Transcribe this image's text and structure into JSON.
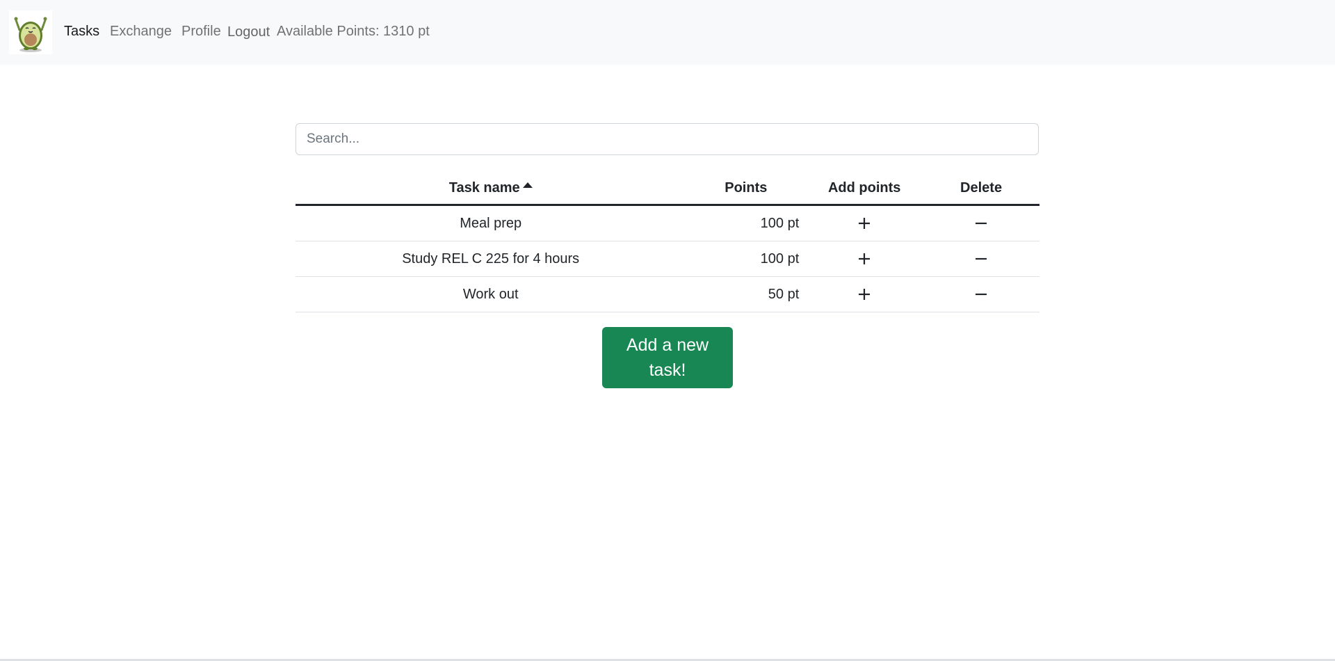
{
  "nav": {
    "links": [
      {
        "label": "Tasks",
        "active": true
      },
      {
        "label": "Exchange",
        "active": false
      },
      {
        "label": "Profile",
        "active": false
      }
    ],
    "logout_label": "Logout",
    "available_points": "Available Points: 1310 pt",
    "logo_icon": "avocado-mascot-icon"
  },
  "search": {
    "placeholder": "Search...",
    "value": ""
  },
  "table": {
    "headers": {
      "name": "Task name",
      "points": "Points",
      "add": "Add points",
      "delete": "Delete"
    },
    "sort": {
      "column": "name",
      "direction": "ascending",
      "icon": "caret-up-icon"
    },
    "rows": [
      {
        "name": "Meal prep",
        "points": "100 pt"
      },
      {
        "name": "Study REL C 225 for 4 hours",
        "points": "100 pt"
      },
      {
        "name": "Work out",
        "points": "50 pt"
      }
    ],
    "add_icon": "plus-icon",
    "delete_icon": "minus-icon"
  },
  "add_task_button": {
    "label": "Add a new task!"
  },
  "colors": {
    "navbar_bg": "#f8f9fa",
    "primary_button": "#198754",
    "text": "#212529"
  }
}
